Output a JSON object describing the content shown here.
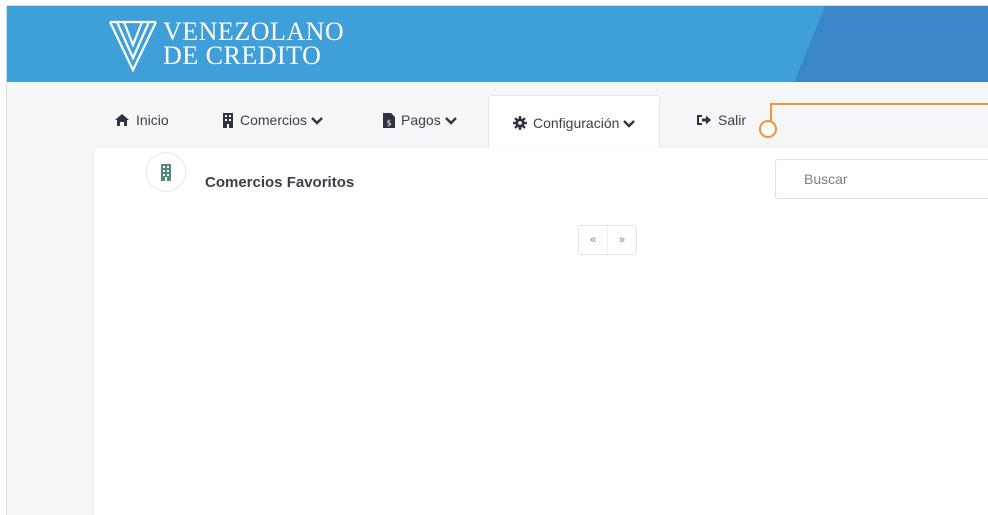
{
  "brand": {
    "line1": "VENEZOLANO",
    "line2": "DE CREDITO",
    "colors": {
      "header": "#3f9fd8",
      "accent": "#3a86c8",
      "callout": "#f0962a",
      "link": "#4c8fd0"
    }
  },
  "nav": {
    "items": [
      {
        "label": "Inicio",
        "icon": "home-icon"
      },
      {
        "label": "Comercios",
        "icon": "building-icon",
        "dropdown": true
      },
      {
        "label": "Pagos",
        "icon": "invoice-icon",
        "dropdown": true
      },
      {
        "label": "Configuración",
        "icon": "gear-icon",
        "dropdown": true,
        "active": true
      },
      {
        "label": "Salir",
        "icon": "sign-out-icon"
      }
    ]
  },
  "main": {
    "title": "Comercios Favoritos",
    "icon": "building-icon",
    "search": {
      "placeholder": "Buscar",
      "value": ""
    },
    "pager": {
      "prev": "«",
      "next": "»"
    }
  }
}
